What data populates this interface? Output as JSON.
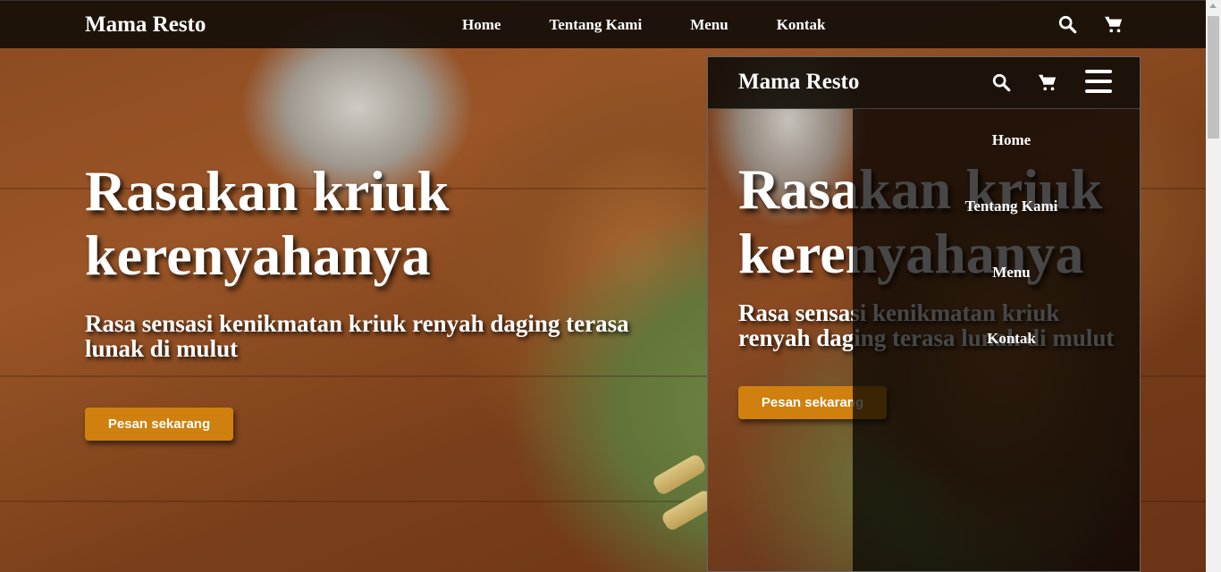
{
  "brand": "Mama Resto",
  "nav": {
    "links": [
      "Home",
      "Tentang Kami",
      "Menu",
      "Kontak"
    ],
    "icons": [
      "search-icon",
      "cart-icon"
    ]
  },
  "hero": {
    "title": "Rasakan kriuk kerenyahanya",
    "subtitle": "Rasa sensasi kenikmatan kriuk renyah daging terasa lunak di mulut",
    "cta": "Pesan sekarang"
  },
  "mobile_preview": {
    "brand": "Mama Resto",
    "icons": [
      "search-icon",
      "cart-icon",
      "hamburger-menu-icon"
    ],
    "menu": [
      "Home",
      "Tentang Kami",
      "Menu",
      "Kontak"
    ],
    "title": "Rasakan kriuk kerenyahanya",
    "subtitle": "Rasa sensasi kenikmatan kriuk renyah daging terasa lunak di mulut",
    "cta": "Pesan sekarang"
  },
  "colors": {
    "accent": "#d0800e",
    "navbar": "#140e08",
    "text": "#ffffff"
  }
}
